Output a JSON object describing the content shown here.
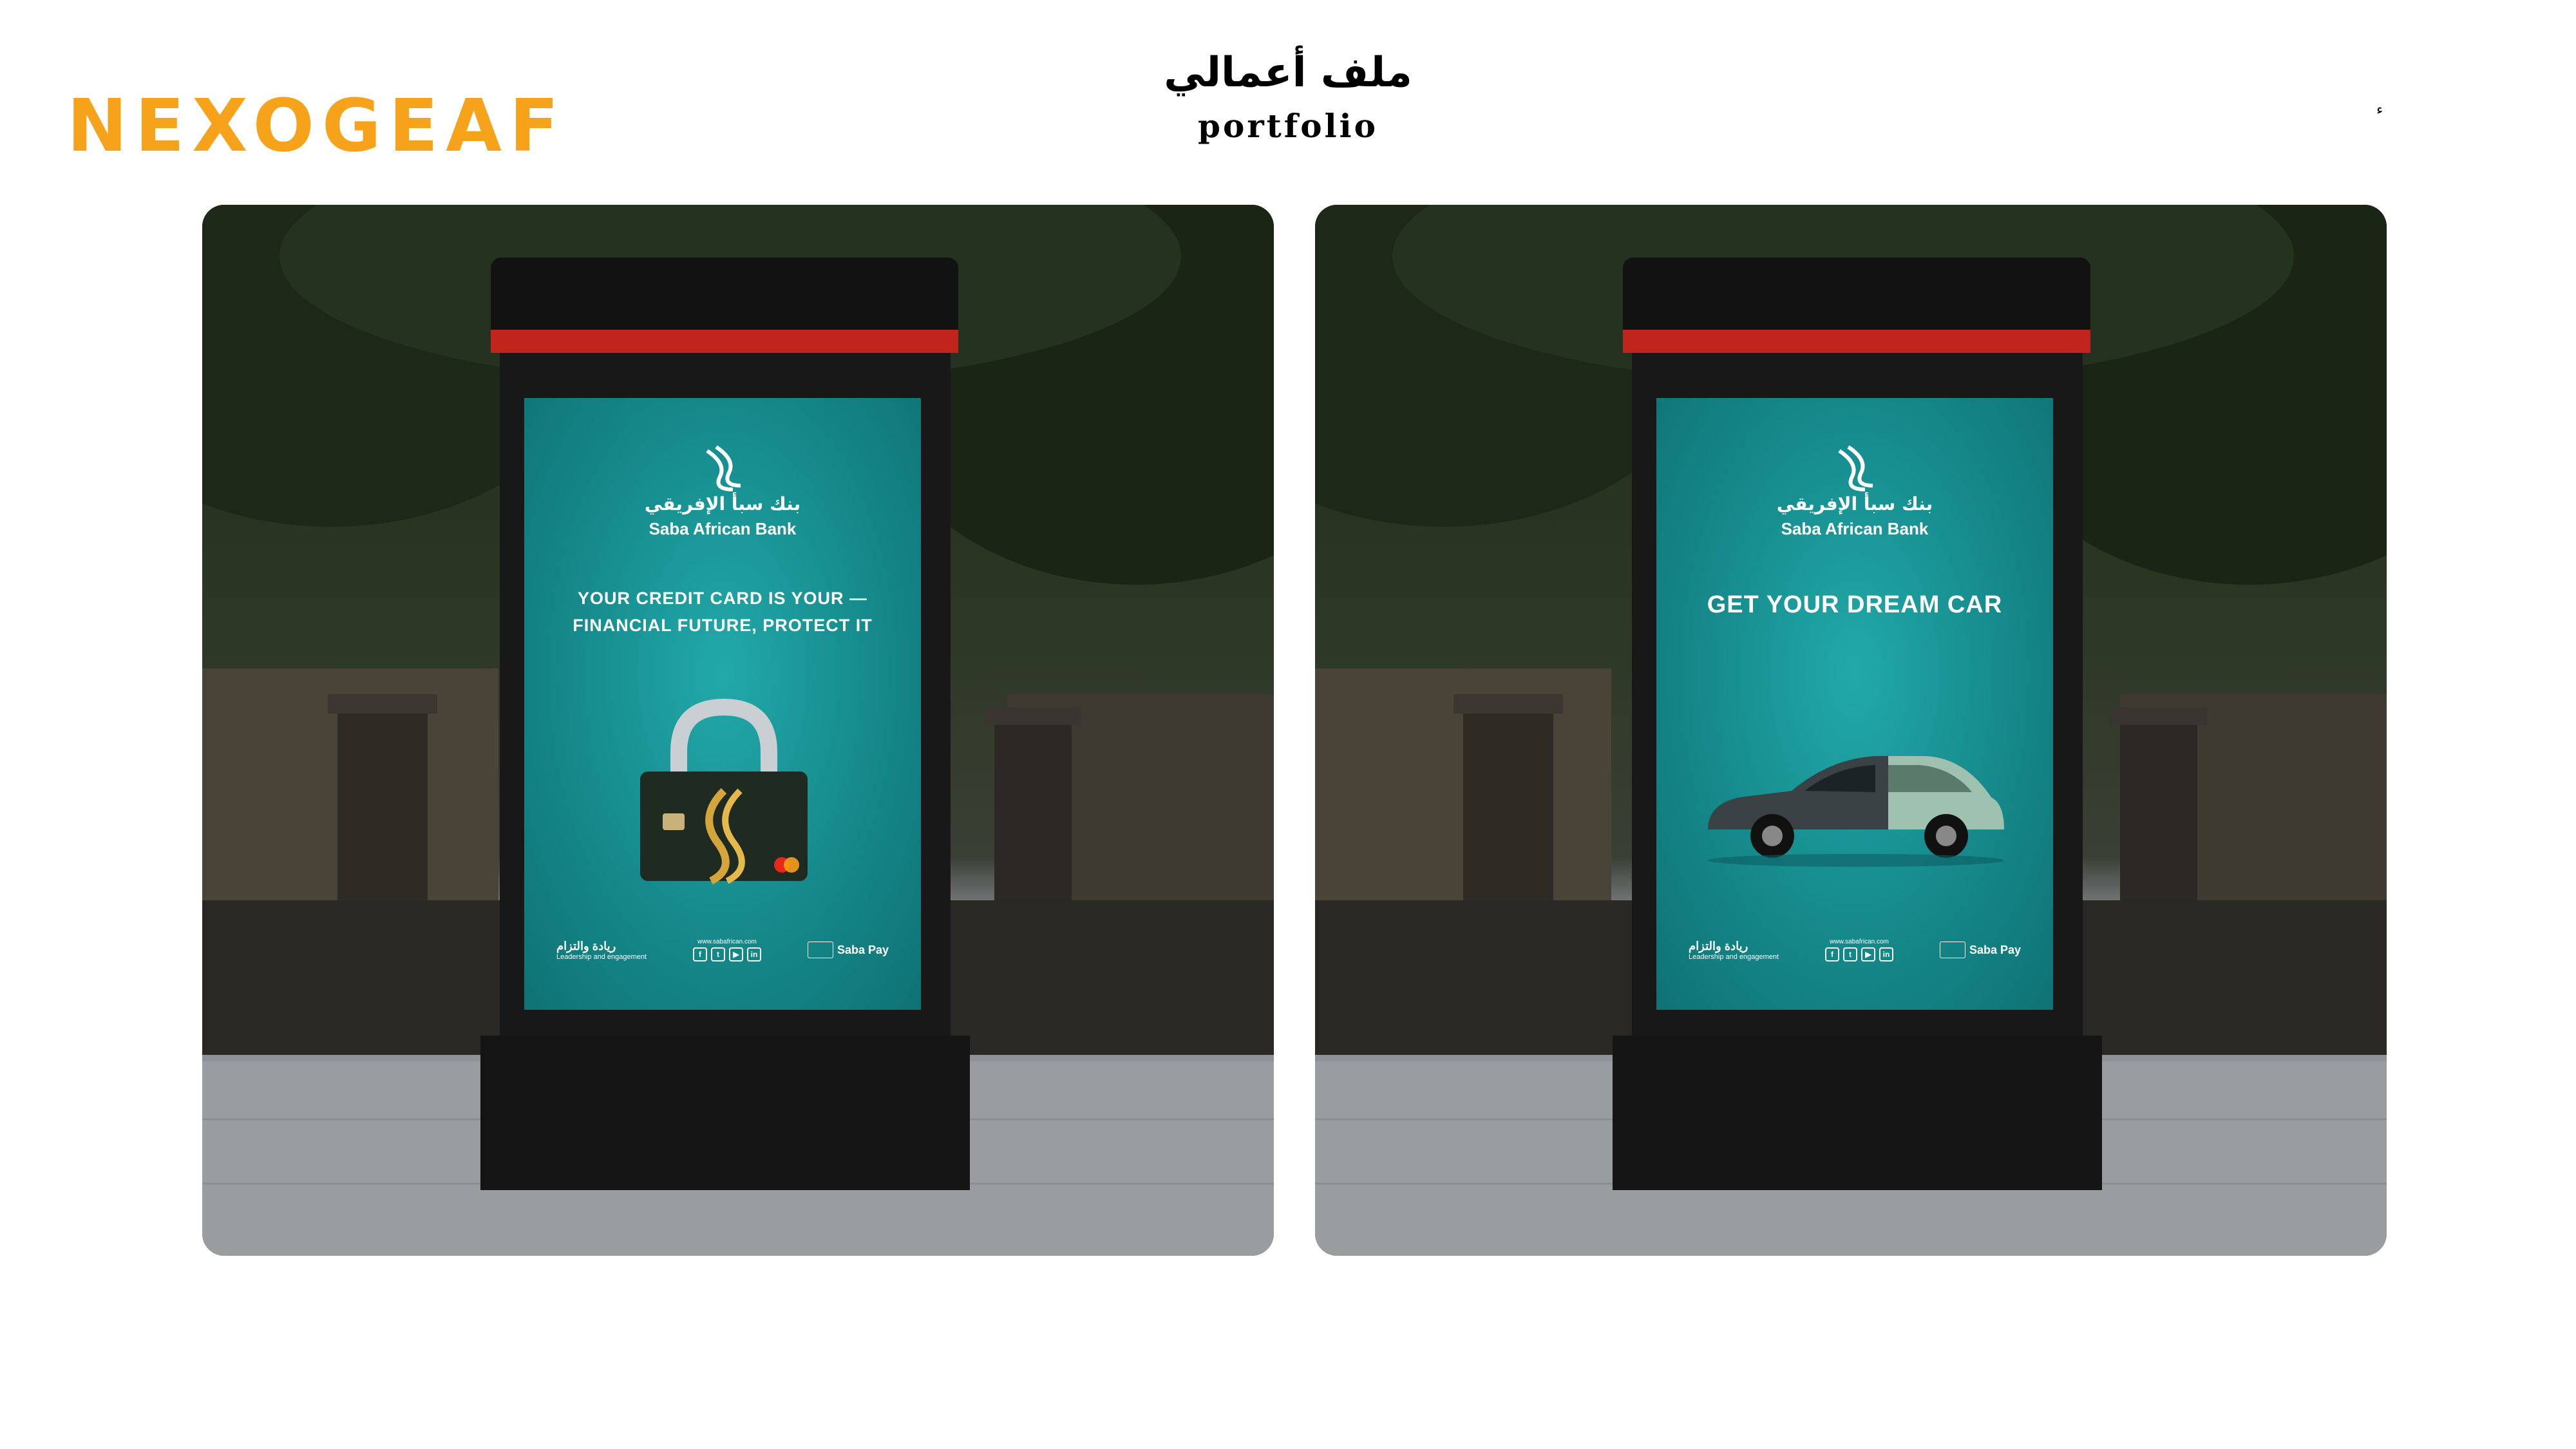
{
  "header": {
    "logo": "NEXOGEAF",
    "title_ar": "ملف أعمالي",
    "title_en": "portfolio",
    "page_mark": "ء"
  },
  "colors": {
    "brand_orange": "#f7a21b",
    "poster_teal": "#15898b",
    "kiosk_black": "#151515",
    "kiosk_red": "#c0241c"
  },
  "posters": [
    {
      "bank_name_ar": "بنك سبأ الإفريقي",
      "bank_name_en": "Saba African Bank",
      "headline_line1": "YOUR CREDIT CARD IS YOUR —",
      "headline_line2": "FINANCIAL FUTURE, PROTECT IT",
      "illustration": "padlock-credit-card",
      "footer": {
        "slogan_ar": "ريادة والتزام",
        "slogan_en": "Leadership and engagement",
        "url": "www.sabafrican.com",
        "socials": [
          "f",
          "t",
          "▶",
          "in"
        ],
        "pay_brand": "Saba Pay"
      }
    },
    {
      "bank_name_ar": "بنك سبأ الإفريقي",
      "bank_name_en": "Saba African Bank",
      "headline_line1": "GET YOUR DREAM CAR",
      "illustration": "hatchback-car",
      "footer": {
        "slogan_ar": "ريادة والتزام",
        "slogan_en": "Leadership and engagement",
        "url": "www.sabafrican.com",
        "socials": [
          "f",
          "t",
          "▶",
          "in"
        ],
        "pay_brand": "Saba Pay"
      }
    }
  ]
}
